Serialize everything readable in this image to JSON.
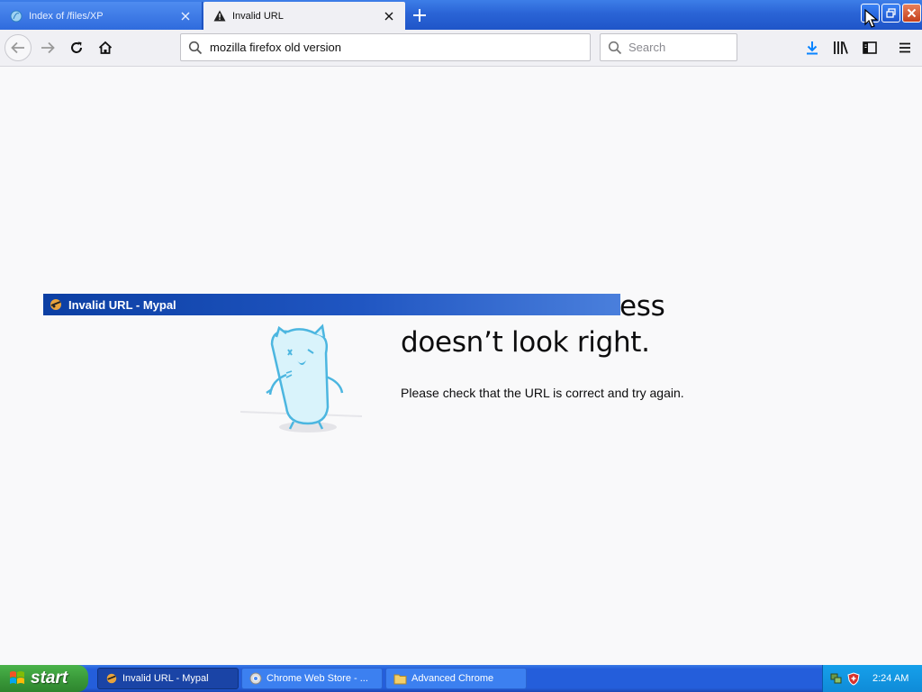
{
  "tabs": [
    {
      "label": "Index of /files/XP",
      "icon": "mypal-icon"
    },
    {
      "label": "Invalid URL",
      "icon": "warning-icon"
    }
  ],
  "navbar": {
    "url": "mozilla firefox old version",
    "search_placeholder": "Search"
  },
  "error": {
    "title_line1": "ess",
    "title_line2": "doesn’t look right.",
    "description": "Please check that the URL is correct and try again."
  },
  "floating_window": {
    "title": "Invalid URL - Mypal"
  },
  "taskbar": {
    "start_label": "start",
    "items": [
      {
        "label": "Invalid URL - Mypal",
        "icon": "mypal-icon",
        "active": true
      },
      {
        "label": "Chrome Web Store - ...",
        "icon": "chrome-icon",
        "active": false
      },
      {
        "label": "Advanced Chrome",
        "icon": "folder-icon",
        "active": false
      }
    ],
    "clock": "2:24 AM"
  },
  "colors": {
    "titlebar_blue": "#2a64d6",
    "page_background": "#f9f9fa",
    "download_blue": "#0a84ff",
    "taskbar_blue": "#245edb",
    "start_green": "#3a9a3a"
  }
}
